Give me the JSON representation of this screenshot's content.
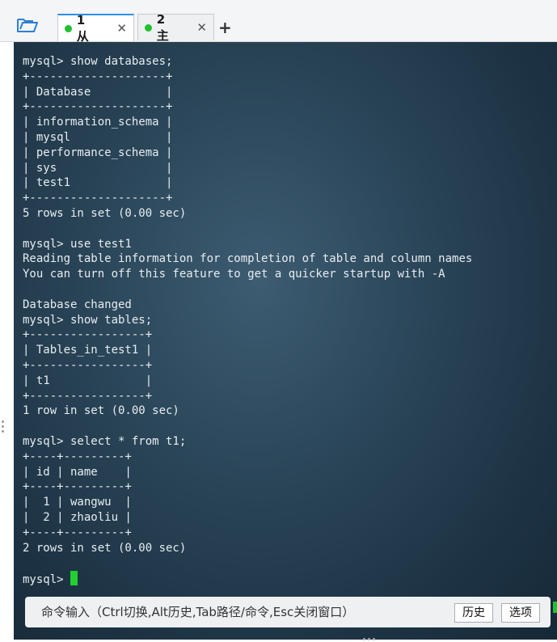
{
  "tabs": [
    {
      "label": "1 从",
      "status": "connected",
      "active": true
    },
    {
      "label": "2 主",
      "status": "connected",
      "active": false
    }
  ],
  "tab_close_glyph": "✕",
  "add_tab_glyph": "+",
  "terminal": {
    "lines": [
      "mysql> show databases;",
      "+--------------------+",
      "| Database           |",
      "+--------------------+",
      "| information_schema |",
      "| mysql              |",
      "| performance_schema |",
      "| sys                |",
      "| test1              |",
      "+--------------------+",
      "5 rows in set (0.00 sec)",
      "",
      "mysql> use test1",
      "Reading table information for completion of table and column names",
      "You can turn off this feature to get a quicker startup with -A",
      "",
      "Database changed",
      "mysql> show tables;",
      "+-----------------+",
      "| Tables_in_test1 |",
      "+-----------------+",
      "| t1              |",
      "+-----------------+",
      "1 row in set (0.00 sec)",
      "",
      "mysql> select * from t1;",
      "+----+---------+",
      "| id | name    |",
      "+----+---------+",
      "|  1 | wangwu  |",
      "|  2 | zhaoliu |",
      "+----+---------+",
      "2 rows in set (0.00 sec)",
      ""
    ],
    "prompt": "mysql> "
  },
  "command_bar": {
    "placeholder": "命令输入（Ctrl切换,Alt历史,Tab路径/命令,Esc关闭窗口）",
    "history_label": "历史",
    "options_label": "选项"
  },
  "colors": {
    "accent": "#2f8ee8",
    "status_green": "#22c031",
    "cursor": "#22d02f",
    "terminal_bg": "#2a4558",
    "terminal_text": "#e7edf1"
  },
  "icons": {
    "open_session": "folder-open-icon",
    "tab_status": "green-dot-icon",
    "tab_close": "close-icon",
    "new_tab": "plus-icon"
  }
}
